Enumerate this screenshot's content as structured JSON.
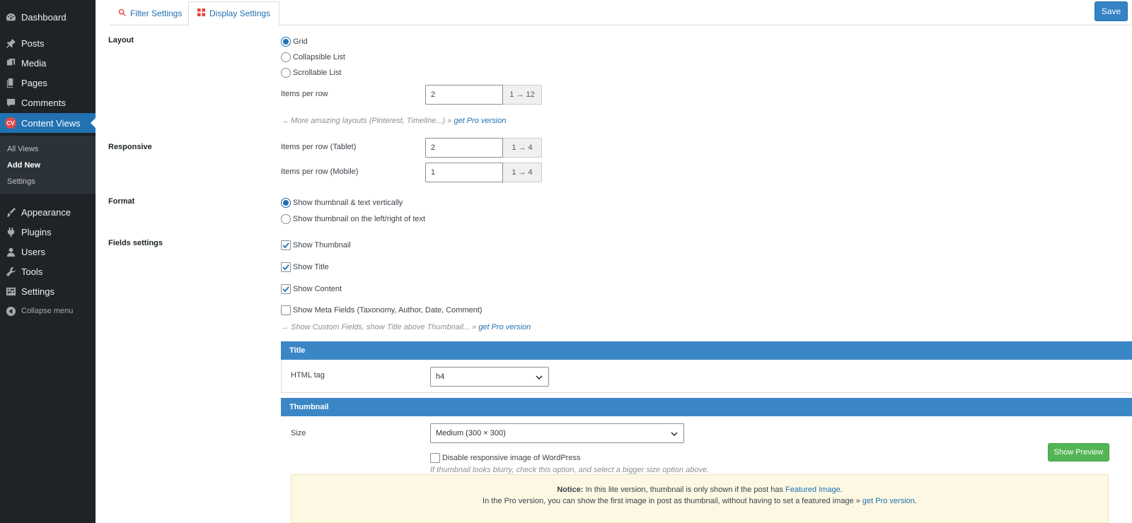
{
  "sidebar": {
    "items": [
      {
        "label": "Dashboard",
        "icon": "dashboard-icon"
      },
      {
        "label": "Posts",
        "icon": "pin-icon"
      },
      {
        "label": "Media",
        "icon": "media-icon"
      },
      {
        "label": "Pages",
        "icon": "page-icon"
      },
      {
        "label": "Comments",
        "icon": "comment-icon"
      },
      {
        "label": "Content Views",
        "icon": "cv-icon",
        "badge": "CV"
      },
      {
        "label": "Appearance",
        "icon": "brush-icon"
      },
      {
        "label": "Plugins",
        "icon": "plugin-icon"
      },
      {
        "label": "Users",
        "icon": "user-icon"
      },
      {
        "label": "Tools",
        "icon": "wrench-icon"
      },
      {
        "label": "Settings",
        "icon": "settings-icon"
      }
    ],
    "submenu": [
      "All Views",
      "Add New",
      "Settings"
    ],
    "collapse": "Collapse menu"
  },
  "tabs": [
    {
      "label": "Filter Settings",
      "icon": "search-icon"
    },
    {
      "label": "Display Settings",
      "icon": "grid-icon"
    }
  ],
  "save_label": "Save",
  "layout": {
    "label": "Layout",
    "options": [
      "Grid",
      "Collapsible List",
      "Scrollable List"
    ],
    "selected": "Grid",
    "items_per_row_label": "Items per row",
    "items_per_row_value": "2",
    "items_per_row_range": "1 → 12",
    "hint_text": "→ More amazing layouts (Pinterest, Timeline...) »",
    "hint_link": "get Pro version"
  },
  "responsive": {
    "label": "Responsive",
    "tablet_label": "Items per row (Tablet)",
    "tablet_value": "2",
    "tablet_range": "1 → 4",
    "mobile_label": "Items per row (Mobile)",
    "mobile_value": "1",
    "mobile_range": "1 → 4"
  },
  "format": {
    "label": "Format",
    "options": [
      "Show thumbnail & text vertically",
      "Show thumbnail on the left/right of text"
    ],
    "selected": "Show thumbnail & text vertically"
  },
  "fields": {
    "label": "Fields settings",
    "items": [
      {
        "label": "Show Thumbnail",
        "checked": true
      },
      {
        "label": "Show Title",
        "checked": true
      },
      {
        "label": "Show Content",
        "checked": true
      },
      {
        "label": "Show Meta Fields (Taxonomy, Author, Date, Comment)",
        "checked": false
      }
    ],
    "hint_text": "→ Show Custom Fields, show Title above Thumbnail... »",
    "hint_link": "get Pro version"
  },
  "title_panel": {
    "heading": "Title",
    "html_tag_label": "HTML tag",
    "html_tag_value": "h4"
  },
  "thumbnail_panel": {
    "heading": "Thumbnail",
    "size_label": "Size",
    "size_value": "Medium (300 × 300)",
    "disable_label": "Disable responsive image of WordPress",
    "disable_checked": false,
    "disable_hint": "If thumbnail looks blurry, check this option, and select a bigger size option above.",
    "preview_label": "Show Preview"
  },
  "notice": {
    "prefix": "Notice:",
    "line1_text": "In this lite version, thumbnail is only shown if the post has",
    "line1_link": "Featured Image",
    "line2_text": "In the Pro version, you can show the first image in post as thumbnail, without having to set a featured image »",
    "line2_link": "get Pro version"
  },
  "colors": {
    "admin_sidebar": "#1d2327",
    "accent": "#2271b1",
    "panel_head": "#3b87c6",
    "preview_green": "#53b553",
    "notice_bg": "#fcf8e3"
  }
}
